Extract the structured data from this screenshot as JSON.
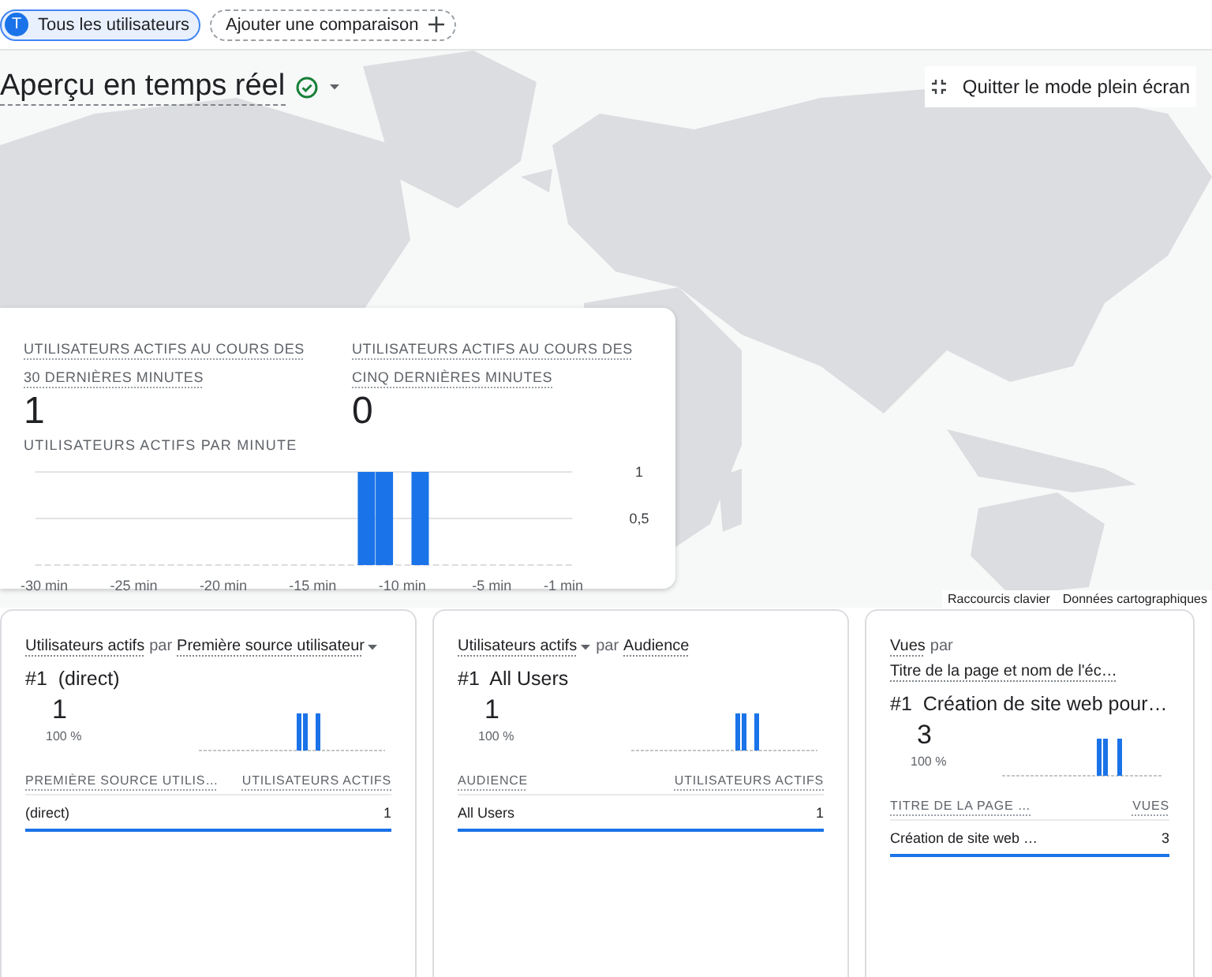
{
  "filters": [
    {
      "kind": "audience",
      "label": "Tous les utilisateurs",
      "avatar": "T"
    },
    {
      "kind": "add",
      "label": "Ajouter une comparaison"
    }
  ],
  "header": {
    "title": "Aperçu en temps réel",
    "exit_fullscreen": "Quitter le mode plein écran"
  },
  "map": {
    "kind": "picture",
    "links": [
      "Raccourcis clavier",
      "Données cartographiques"
    ]
  },
  "realtime": {
    "metrics": [
      {
        "label": "UTILISATEURS ACTIFS AU COURS DES 30 DERNIÈRES MINUTES",
        "value": "1"
      },
      {
        "label": "UTILISATEURS ACTIFS AU COURS DES CINQ DERNIÈRES MINUTES",
        "value": "0"
      }
    ],
    "chart_title": "UTILISATEURS ACTIFS PAR MINUTE",
    "chart_data": {
      "type": "bar",
      "x": [
        -30,
        -29,
        -28,
        -27,
        -26,
        -25,
        -24,
        -23,
        -22,
        -21,
        -20,
        -19,
        -18,
        -17,
        -16,
        -15,
        -14,
        -13,
        -12,
        -11,
        -10,
        -9,
        -8,
        -7,
        -6,
        -5,
        -4,
        -3,
        -2,
        -1
      ],
      "series": [
        {
          "color": "#1a73e8",
          "values": [
            0,
            0,
            0,
            0,
            0,
            0,
            0,
            0,
            0,
            0,
            0,
            0,
            0,
            0,
            0,
            0,
            0,
            0,
            1,
            1,
            0,
            1,
            0,
            0,
            0,
            0,
            0,
            0,
            0,
            0
          ]
        }
      ],
      "xlim": [
        -30.5,
        -0.5
      ],
      "ylim": [
        0,
        1
      ],
      "xticks": [
        {
          "value": -30,
          "label": "-30 min"
        },
        {
          "value": -25,
          "label": "-25 min"
        },
        {
          "value": -20,
          "label": "-20 min"
        },
        {
          "value": -15,
          "label": "-15 min"
        },
        {
          "value": -10,
          "label": "-10 min"
        },
        {
          "value": -5,
          "label": "-5 min"
        },
        {
          "value": -1,
          "label": "-1 min"
        }
      ],
      "yticks": [
        {
          "value": 1,
          "label": "1"
        },
        {
          "value": 0.5,
          "label": "0,5"
        }
      ]
    }
  },
  "cards": [
    {
      "title": {
        "metric": "Utilisateurs actifs",
        "connector": "par",
        "dimension": "Première source utilisateur",
        "metric_menu": false,
        "dimension_menu": true
      },
      "top": {
        "rank": "#1",
        "name": "(direct)",
        "value": "1",
        "share": "100 %"
      },
      "columns": [
        "PREMIÈRE SOURCE UTILIS…",
        "UTILISATEURS ACTIFS"
      ],
      "rows": [
        {
          "cells": [
            "(direct)",
            "1"
          ],
          "selected": true
        }
      ]
    },
    {
      "title": {
        "metric": "Utilisateurs actifs",
        "connector": "par",
        "dimension": "Audience",
        "metric_menu": true,
        "dimension_menu": false
      },
      "top": {
        "rank": "#1",
        "name": "All Users",
        "value": "1",
        "share": "100 %"
      },
      "columns": [
        "AUDIENCE",
        "UTILISATEURS ACTIFS"
      ],
      "rows": [
        {
          "cells": [
            "All Users",
            "1"
          ],
          "selected": true
        }
      ]
    },
    {
      "title": {
        "metric": "Vues",
        "connector": "par",
        "dimension": "Titre de la page et nom de l'éc…",
        "metric_menu": false,
        "dimension_menu": false
      },
      "top": {
        "rank": "#1",
        "name": "Création de site web pour…",
        "value": "3",
        "share": "100 %"
      },
      "columns": [
        "TITRE DE LA PAGE …",
        "VUES"
      ],
      "rows": [
        {
          "cells": [
            "Création de site web …",
            "3"
          ],
          "selected": true
        }
      ]
    }
  ]
}
